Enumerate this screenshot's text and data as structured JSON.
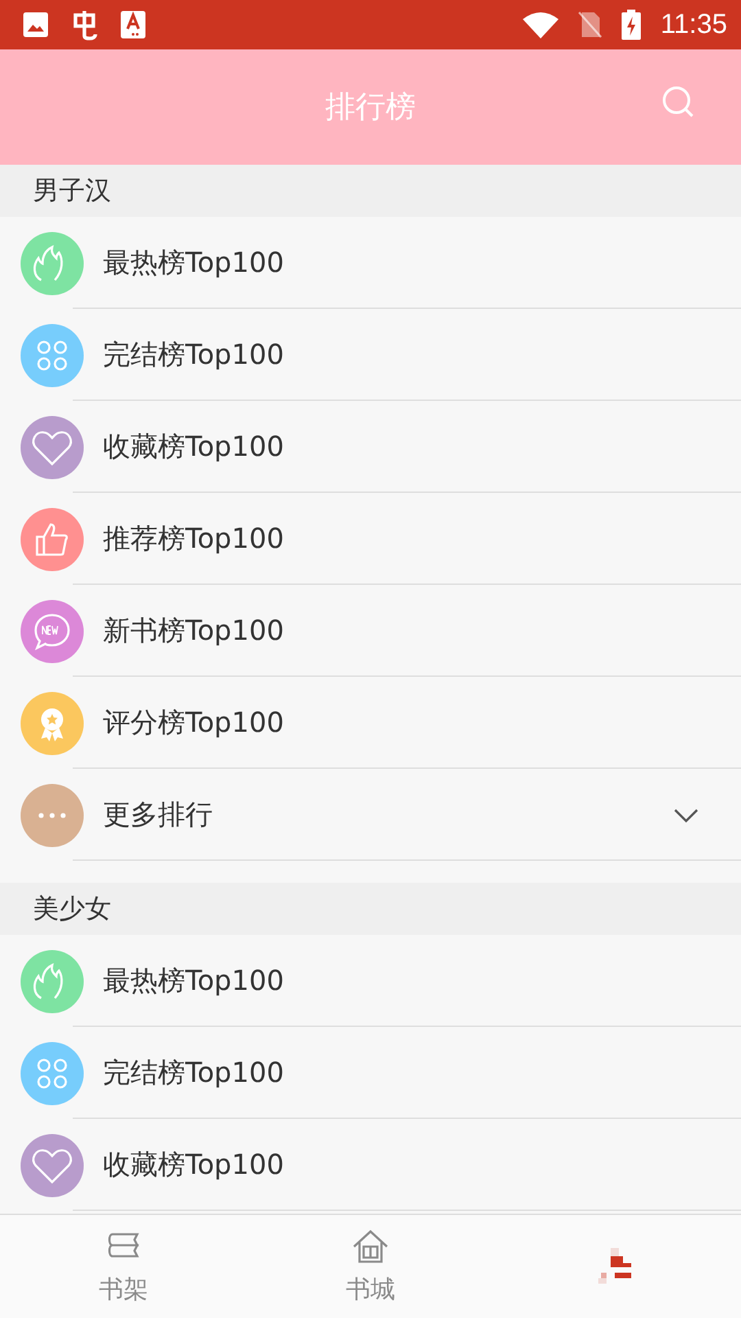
{
  "status_bar": {
    "time": "11:35"
  },
  "header": {
    "title": "排行榜"
  },
  "sections": [
    {
      "title": "男子汉",
      "items": [
        {
          "kind": "flame",
          "color": "#7ee3a2",
          "label": "最热榜Top100"
        },
        {
          "kind": "clover",
          "color": "#77cdfc",
          "label": "完结榜Top100"
        },
        {
          "kind": "heart",
          "color": "#b89ccc",
          "label": "收藏榜Top100"
        },
        {
          "kind": "thumb",
          "color": "#ff9090",
          "label": "推荐榜Top100"
        },
        {
          "kind": "new",
          "color": "#dc88d8",
          "label": "新书榜Top100"
        },
        {
          "kind": "medal",
          "color": "#fbc75e",
          "label": "评分榜Top100"
        },
        {
          "kind": "more",
          "color": "#d9b192",
          "label": "更多排行",
          "expanded": false
        }
      ]
    },
    {
      "title": "美少女",
      "items": [
        {
          "kind": "flame",
          "color": "#7ee3a2",
          "label": "最热榜Top100"
        },
        {
          "kind": "clover",
          "color": "#77cdfc",
          "label": "完结榜Top100"
        },
        {
          "kind": "heart",
          "color": "#b89ccc",
          "label": "收藏榜Top100"
        }
      ]
    }
  ],
  "tabs": [
    {
      "kind": "shelf",
      "label": "书架",
      "selected": false
    },
    {
      "kind": "store",
      "label": "书城",
      "selected": false
    },
    {
      "kind": "rank",
      "selected": true
    }
  ]
}
